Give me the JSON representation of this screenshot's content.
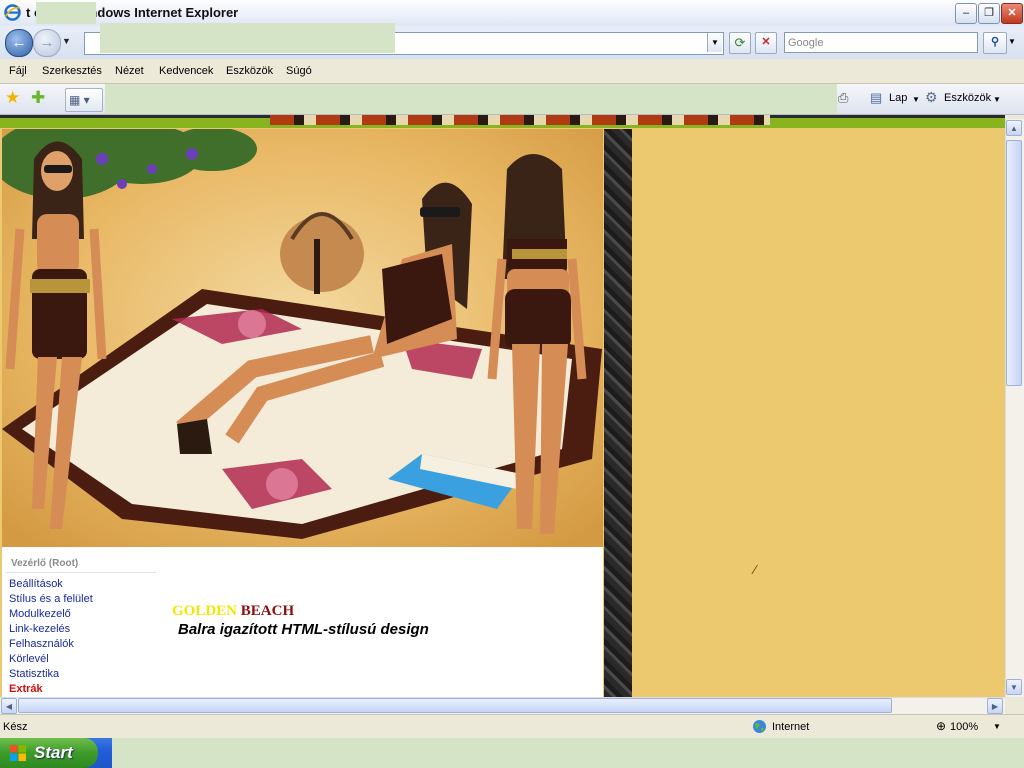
{
  "window": {
    "title": "t          ortál - Windows Internet Explorer",
    "minimize": "–",
    "maximize": "❐",
    "close": "✕"
  },
  "toolbar": {
    "back_glyph": "←",
    "forward_glyph": "→",
    "refresh_glyph": "⟳",
    "stop_glyph": "✕",
    "search_placeholder": "Google",
    "search_button_glyph": "⚲"
  },
  "menu": {
    "items": [
      "Fájl",
      "Szerkesztés",
      "Nézet",
      "Kedvencek",
      "Eszközök",
      "Súgó"
    ]
  },
  "favorites_bar": {
    "page_label": "Lap",
    "tools_label": "Eszközök"
  },
  "page": {
    "sidebar_heading": "Vezérlő (Root)",
    "sidebar_links": [
      "Beállítások",
      "Stílus és a felület",
      "Modulkezelő",
      "Link-kezelés",
      "Felhasználók",
      "Körlevél",
      "Statisztika"
    ],
    "sidebar_active_link": "Extrák",
    "title_part1": "GOLDEN",
    "title_part2": "BEACH",
    "subtitle": "Balra igazított HTML-stílusú design",
    "colors": {
      "title_part1": "#f0e800",
      "title_part2": "#8b0d0d",
      "background": "#ecc86f",
      "accent_green": "#88b51f"
    }
  },
  "statusbar": {
    "status": "Kész",
    "zone": "Internet",
    "zoom": "100%"
  },
  "taskbar": {
    "start_label": "Start"
  }
}
